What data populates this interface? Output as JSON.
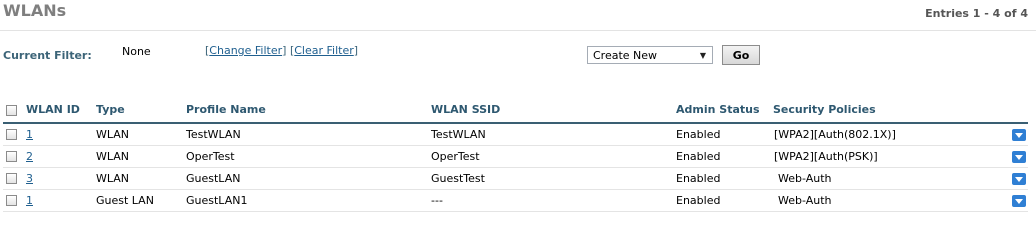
{
  "page": {
    "title": "WLANs",
    "entries": "Entries 1 - 4 of 4"
  },
  "filter": {
    "label": "Current Filter:",
    "value": "None",
    "change_label": "Change Filter",
    "clear_label": "Clear Filter"
  },
  "action": {
    "selected": "Create New",
    "go_label": "Go"
  },
  "table": {
    "headers": {
      "id": "WLAN ID",
      "type": "Type",
      "profile": "Profile Name",
      "ssid": "WLAN SSID",
      "status": "Admin Status",
      "security": "Security Policies"
    },
    "rows": [
      {
        "id": "1",
        "type": "WLAN",
        "profile": "TestWLAN",
        "ssid": "TestWLAN",
        "status": "Enabled",
        "security": "[WPA2][Auth(802.1X)]"
      },
      {
        "id": "2",
        "type": "WLAN",
        "profile": "OperTest",
        "ssid": "OperTest",
        "status": "Enabled",
        "security": "[WPA2][Auth(PSK)]"
      },
      {
        "id": "3",
        "type": "WLAN",
        "profile": "GuestLAN",
        "ssid": "GuestTest",
        "status": "Enabled",
        "security": "Web-Auth"
      },
      {
        "id": "1",
        "type": "Guest LAN",
        "profile": "GuestLAN1",
        "ssid": "---",
        "status": "Enabled",
        "security": "Web-Auth"
      }
    ]
  },
  "icons": {
    "row_menu": "chevron-down-icon",
    "row_menu_color": "#2f7fd4"
  }
}
